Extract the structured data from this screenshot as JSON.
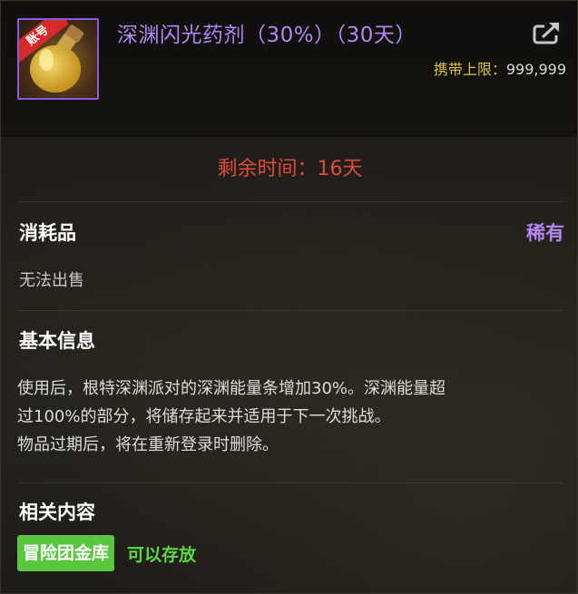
{
  "item": {
    "title": "深渊闪光药剂（30%）（30天）",
    "icon_badge": "账号",
    "icon_name": "potion-bottle-icon",
    "carry_limit_label": "携带上限：",
    "carry_limit_value": "999,999"
  },
  "remaining_time": "剩余时间：16天",
  "category": "消耗品",
  "rarity": "稀有",
  "trade_status": "无法出售",
  "basic_info": {
    "heading": "基本信息",
    "lines": [
      "使用后，根特深渊派对的深渊能量条增加30%。深渊能量超",
      "过100%的部分，将储存起来并适用于下一次挑战。",
      "物品过期后，将在重新登录时删除。"
    ]
  },
  "related": {
    "heading": "相关内容",
    "storage_tag": "冒险团金库",
    "storage_status": "可以存放"
  },
  "colors": {
    "title_purple": "#b187f2",
    "remaining_red": "#e04a3a",
    "carry_gold": "#e0c34a",
    "storage_green": "#5ac53e",
    "status_green": "#5fd843"
  }
}
